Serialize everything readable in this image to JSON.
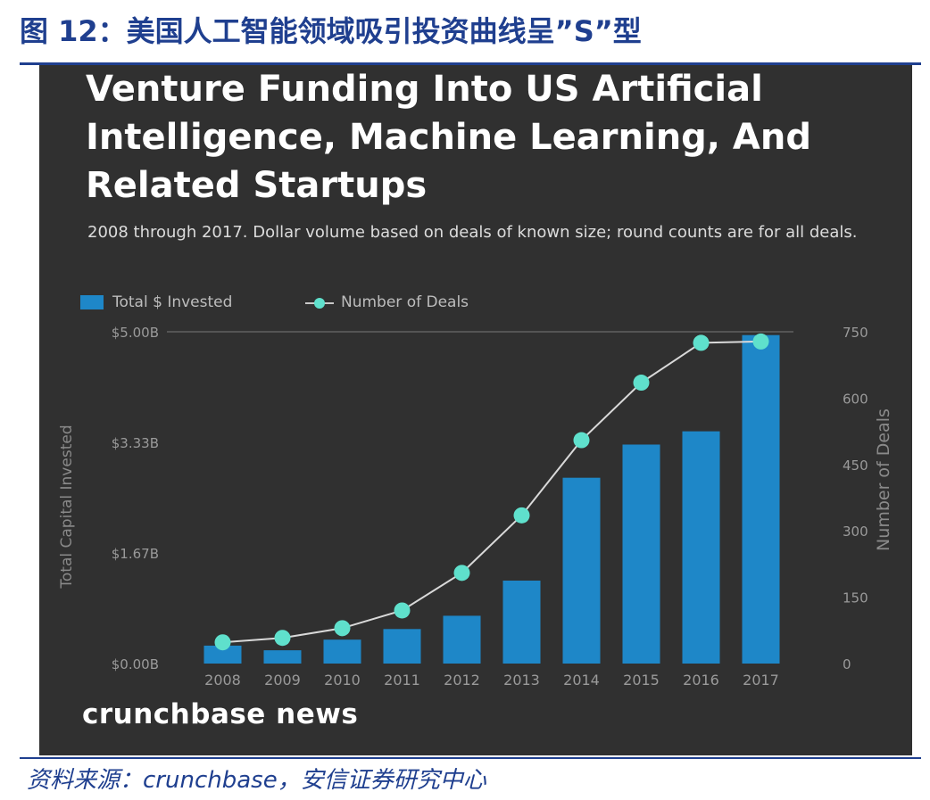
{
  "figure": {
    "title": "图 12：美国人工智能领域吸引投资曲线呈”S”型",
    "source": "资料来源：crunchbase，安信证券研究中心"
  },
  "chart_panel": {
    "brand": "crunchbase news"
  },
  "chart_data": {
    "type": "bar",
    "title": "Venture Funding Into US Artificial Intelligence, Machine Learning, And Related Startups",
    "subtitle": "2008 through 2017. Dollar volume based on deals of known size; round counts are for all deals.",
    "categories": [
      "2008",
      "2009",
      "2010",
      "2011",
      "2012",
      "2013",
      "2014",
      "2015",
      "2016",
      "2017"
    ],
    "series": [
      {
        "name": "Total $ Invested",
        "type": "bar",
        "axis": "left",
        "unit": "USD billions",
        "values": [
          0.27,
          0.2,
          0.36,
          0.52,
          0.72,
          1.25,
          2.8,
          3.3,
          3.5,
          4.95
        ]
      },
      {
        "name": "Number of Deals",
        "type": "line",
        "axis": "right",
        "values": [
          48,
          58,
          80,
          120,
          205,
          335,
          505,
          635,
          725,
          728
        ]
      }
    ],
    "y_left": {
      "label": "Total Capital Invested",
      "ticks": [
        "$0.00B",
        "$1.67B",
        "$3.33B",
        "$5.00B"
      ],
      "range": [
        0,
        5
      ]
    },
    "y_right": {
      "label": "Number of Deals",
      "ticks": [
        "0",
        "150",
        "300",
        "450",
        "600",
        "750"
      ],
      "range": [
        0,
        750
      ]
    },
    "legend_position": "top-left",
    "grid": false,
    "colors": {
      "bar": "#1e87c8",
      "line": "#d9d9d9",
      "marker": "#5fe0cc",
      "background": "#303030"
    }
  }
}
